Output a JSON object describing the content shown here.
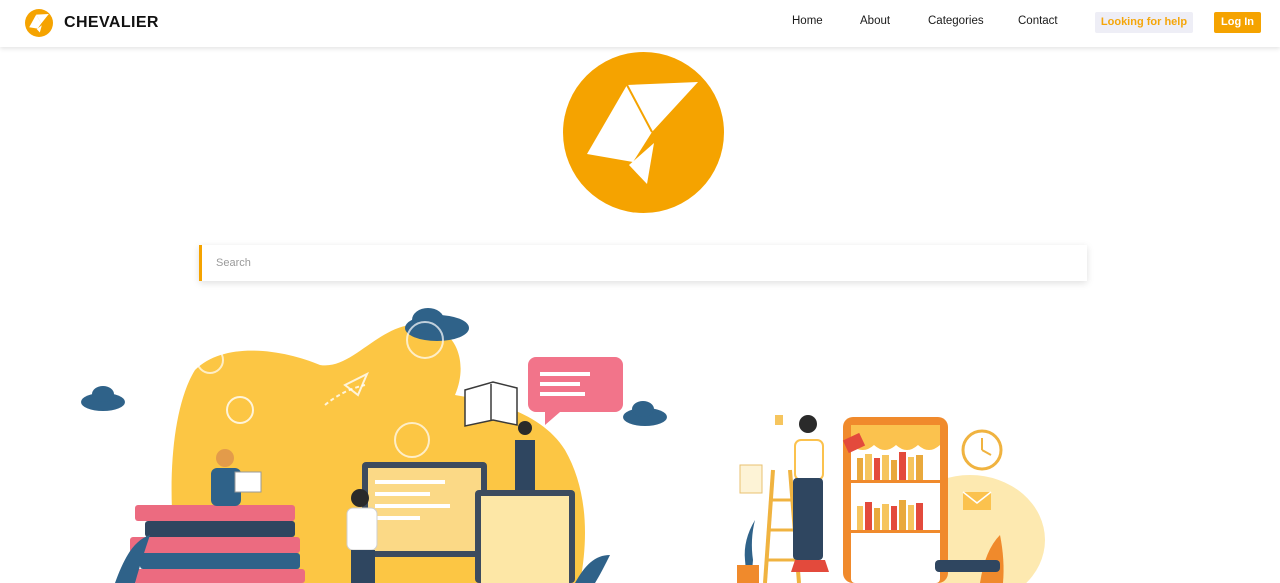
{
  "brand": {
    "name": "CHEVALIER",
    "logo_icon": "paper-plane-logo-icon"
  },
  "nav": {
    "items": [
      {
        "label": "Home"
      },
      {
        "label": "About"
      },
      {
        "label": "Categories"
      },
      {
        "label": "Contact"
      }
    ],
    "help_label": "Looking for help",
    "login_label": "Log In"
  },
  "search": {
    "placeholder": "Search",
    "value": ""
  },
  "colors": {
    "accent": "#f5a300",
    "help_bg": "#eeeef6",
    "illustration_yellow": "#fcc644"
  },
  "illustrations": {
    "left": "people-studying-books-illustration",
    "right": "person-on-ladder-bookshelf-illustration"
  }
}
